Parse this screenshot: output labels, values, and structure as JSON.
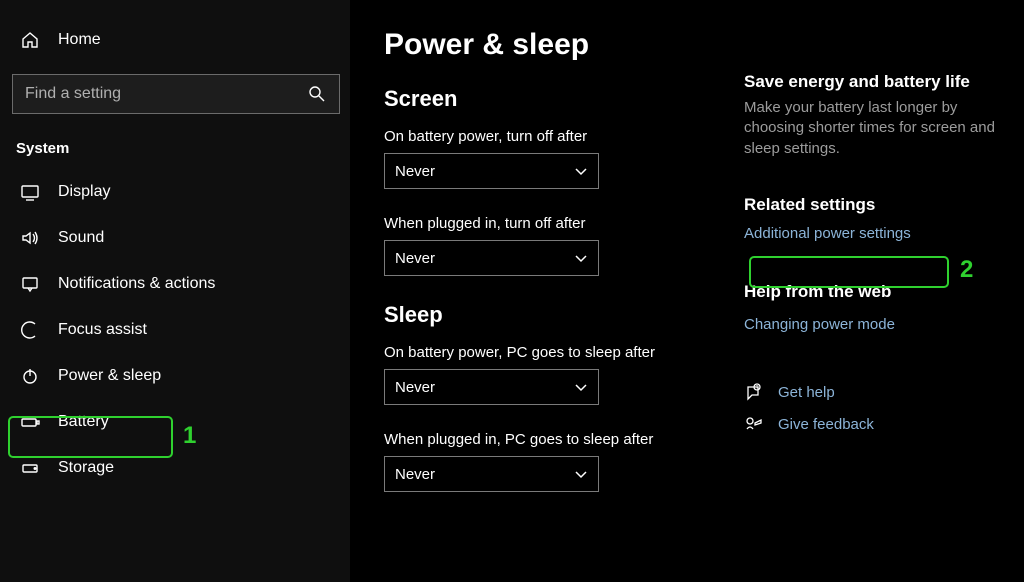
{
  "sidebar": {
    "home": "Home",
    "search_placeholder": "Find a setting",
    "section": "System",
    "items": [
      {
        "id": "display",
        "label": "Display"
      },
      {
        "id": "sound",
        "label": "Sound"
      },
      {
        "id": "notifications",
        "label": "Notifications & actions"
      },
      {
        "id": "focus",
        "label": "Focus assist"
      },
      {
        "id": "power",
        "label": "Power & sleep"
      },
      {
        "id": "battery",
        "label": "Battery"
      },
      {
        "id": "storage",
        "label": "Storage"
      }
    ]
  },
  "page": {
    "title": "Power & sleep"
  },
  "screen": {
    "heading": "Screen",
    "battery_label": "On battery power, turn off after",
    "battery_value": "Never",
    "plugged_label": "When plugged in, turn off after",
    "plugged_value": "Never"
  },
  "sleep": {
    "heading": "Sleep",
    "battery_label": "On battery power, PC goes to sleep after",
    "battery_value": "Never",
    "plugged_label": "When plugged in, PC goes to sleep after",
    "plugged_value": "Never"
  },
  "info": {
    "energy_heading": "Save energy and battery life",
    "energy_text": "Make your battery last longer by choosing shorter times for screen and sleep settings.",
    "related_heading": "Related settings",
    "related_link": "Additional power settings",
    "help_heading": "Help from the web",
    "help_link": "Changing power mode",
    "get_help": "Get help",
    "feedback": "Give feedback"
  },
  "annotations": {
    "one": "1",
    "two": "2"
  }
}
